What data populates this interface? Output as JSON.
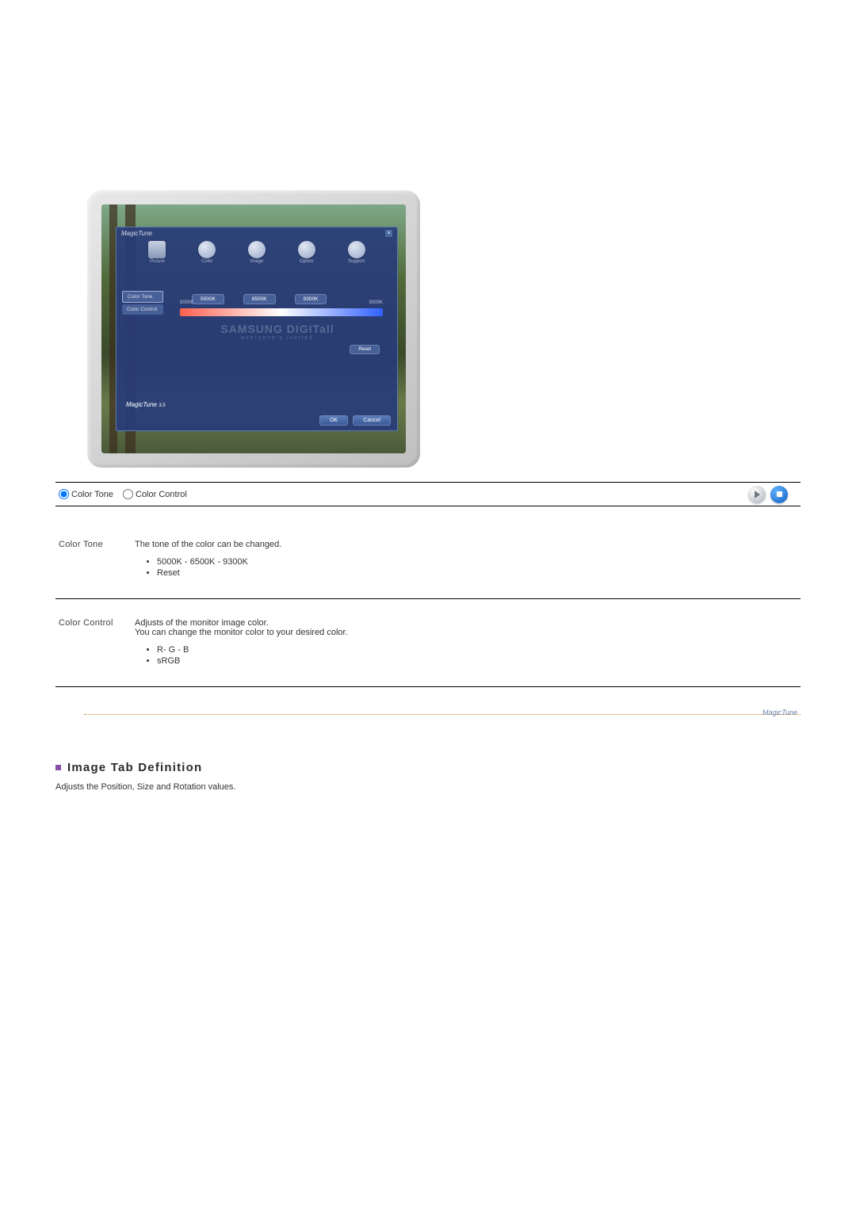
{
  "app": {
    "title": "MagicTune",
    "version": "3.5",
    "ok": "OK",
    "cancel": "Cancel",
    "reset": "Reset",
    "tabs": [
      "Picture",
      "Color",
      "Image",
      "Option",
      "Support"
    ],
    "side": {
      "color_tone": "Color Tone",
      "color_control": "Color Control"
    },
    "temps": {
      "a": "5000K",
      "b": "6500K",
      "c": "9300K",
      "lo": "5000K",
      "hi": "9300K"
    },
    "watermark": {
      "main": "SAMSUNG DIGITall",
      "sub": "everyone's invited"
    }
  },
  "radios": {
    "tone": "Color Tone",
    "control": "Color Control"
  },
  "defs": {
    "color_tone": {
      "label": "Color Tone",
      "intro": "The tone of the color can be changed.",
      "items": [
        "5000K - 6500K - 9300K",
        "Reset"
      ]
    },
    "color_control": {
      "label": "Color Control",
      "intro1": "Adjusts of the monitor image color.",
      "intro2": "You can change the monitor color to your desired color.",
      "items": [
        "R- G - B",
        "sRGB"
      ]
    }
  },
  "brand_small": "MagicTune",
  "image_section": {
    "heading": "Image Tab Definition",
    "desc": "Adjusts the Position, Size and Rotation values."
  }
}
